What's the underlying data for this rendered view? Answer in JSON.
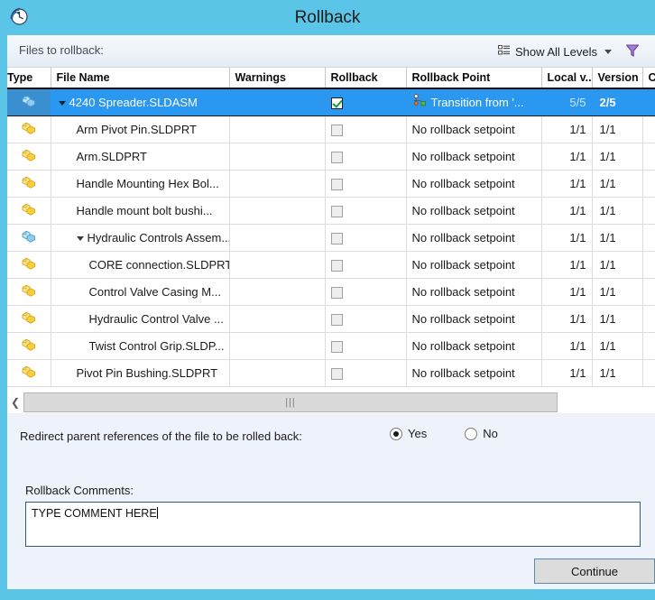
{
  "window": {
    "title": "Rollback",
    "icon": "rollback-clock-icon"
  },
  "toolbar": {
    "label": "Files to rollback:",
    "levels_button": "Show All Levels",
    "levels_icon": "tree-levels-icon",
    "caret_icon": "chevron-down-icon",
    "filter_icon": "filter-funnel-icon"
  },
  "table": {
    "columns": [
      "Type",
      "File Name",
      "Warnings",
      "Rollback",
      "Rollback Point",
      "Local v...",
      "Version",
      "Ch..."
    ],
    "rows": [
      {
        "type_icon": "assembly-icon",
        "name": "4240 Spreader.SLDASM",
        "indent": 0,
        "expander": true,
        "warnings": "",
        "rollback_checked": true,
        "rollback_point": "Transition from '...",
        "rollback_point_icon": "workflow-transition-icon",
        "local_version": "5/5",
        "version": "2/5",
        "checked_out": "",
        "selected": true
      },
      {
        "type_icon": "part-icon",
        "name": "Arm Pivot Pin.SLDPRT",
        "indent": 1,
        "expander": false,
        "warnings": "",
        "rollback_checked": false,
        "rollback_point": "No rollback setpoint",
        "rollback_point_icon": "",
        "local_version": "1/1",
        "version": "1/1",
        "checked_out": "",
        "selected": false
      },
      {
        "type_icon": "part-icon",
        "name": "Arm.SLDPRT",
        "indent": 1,
        "expander": false,
        "warnings": "",
        "rollback_checked": false,
        "rollback_point": "No rollback setpoint",
        "rollback_point_icon": "",
        "local_version": "1/1",
        "version": "1/1",
        "checked_out": "",
        "selected": false
      },
      {
        "type_icon": "part-icon",
        "name": "Handle Mounting Hex Bol...",
        "indent": 1,
        "expander": false,
        "warnings": "",
        "rollback_checked": false,
        "rollback_point": "No rollback setpoint",
        "rollback_point_icon": "",
        "local_version": "1/1",
        "version": "1/1",
        "checked_out": "",
        "selected": false
      },
      {
        "type_icon": "part-icon",
        "name": "Handle mount bolt bushi...",
        "indent": 1,
        "expander": false,
        "warnings": "",
        "rollback_checked": false,
        "rollback_point": "No rollback setpoint",
        "rollback_point_icon": "",
        "local_version": "1/1",
        "version": "1/1",
        "checked_out": "",
        "selected": false
      },
      {
        "type_icon": "assembly-icon",
        "name": "Hydraulic Controls Assem...",
        "indent": 1,
        "expander": true,
        "warnings": "",
        "rollback_checked": false,
        "rollback_point": "No rollback setpoint",
        "rollback_point_icon": "",
        "local_version": "1/1",
        "version": "1/1",
        "checked_out": "",
        "selected": false
      },
      {
        "type_icon": "part-icon",
        "name": "CORE connection.SLDPRT",
        "indent": 2,
        "expander": false,
        "warnings": "",
        "rollback_checked": false,
        "rollback_point": "No rollback setpoint",
        "rollback_point_icon": "",
        "local_version": "1/1",
        "version": "1/1",
        "checked_out": "",
        "selected": false
      },
      {
        "type_icon": "part-icon",
        "name": "Control Valve Casing M...",
        "indent": 2,
        "expander": false,
        "warnings": "",
        "rollback_checked": false,
        "rollback_point": "No rollback setpoint",
        "rollback_point_icon": "",
        "local_version": "1/1",
        "version": "1/1",
        "checked_out": "",
        "selected": false
      },
      {
        "type_icon": "part-icon",
        "name": "Hydraulic Control Valve ...",
        "indent": 2,
        "expander": false,
        "warnings": "",
        "rollback_checked": false,
        "rollback_point": "No rollback setpoint",
        "rollback_point_icon": "",
        "local_version": "1/1",
        "version": "1/1",
        "checked_out": "",
        "selected": false
      },
      {
        "type_icon": "part-icon",
        "name": "Twist Control Grip.SLDP...",
        "indent": 2,
        "expander": false,
        "warnings": "",
        "rollback_checked": false,
        "rollback_point": "No rollback setpoint",
        "rollback_point_icon": "",
        "local_version": "1/1",
        "version": "1/1",
        "checked_out": "",
        "selected": false
      },
      {
        "type_icon": "part-icon",
        "name": "Pivot Pin Bushing.SLDPRT",
        "indent": 1,
        "expander": false,
        "warnings": "",
        "rollback_checked": false,
        "rollback_point": "No rollback setpoint",
        "rollback_point_icon": "",
        "local_version": "1/1",
        "version": "1/1",
        "checked_out": "",
        "selected": false
      }
    ]
  },
  "scrollbar": {
    "left_arrow_icon": "chevron-left-icon",
    "thumb_grip": "|||"
  },
  "options": {
    "redirect_label": "Redirect parent references of the file to be rolled back:",
    "yes_label": "Yes",
    "no_label": "No",
    "selected": "Yes"
  },
  "comments": {
    "label": "Rollback Comments:",
    "value": "TYPE COMMENT HERE"
  },
  "actions": {
    "continue_label": "Continue"
  },
  "colors": {
    "title_bar": "#5bc5e8",
    "selection": "#2a97f0",
    "panel": "#eef2fa",
    "filter_icon": "#8f5fbf",
    "check_green": "#1a9b34"
  }
}
